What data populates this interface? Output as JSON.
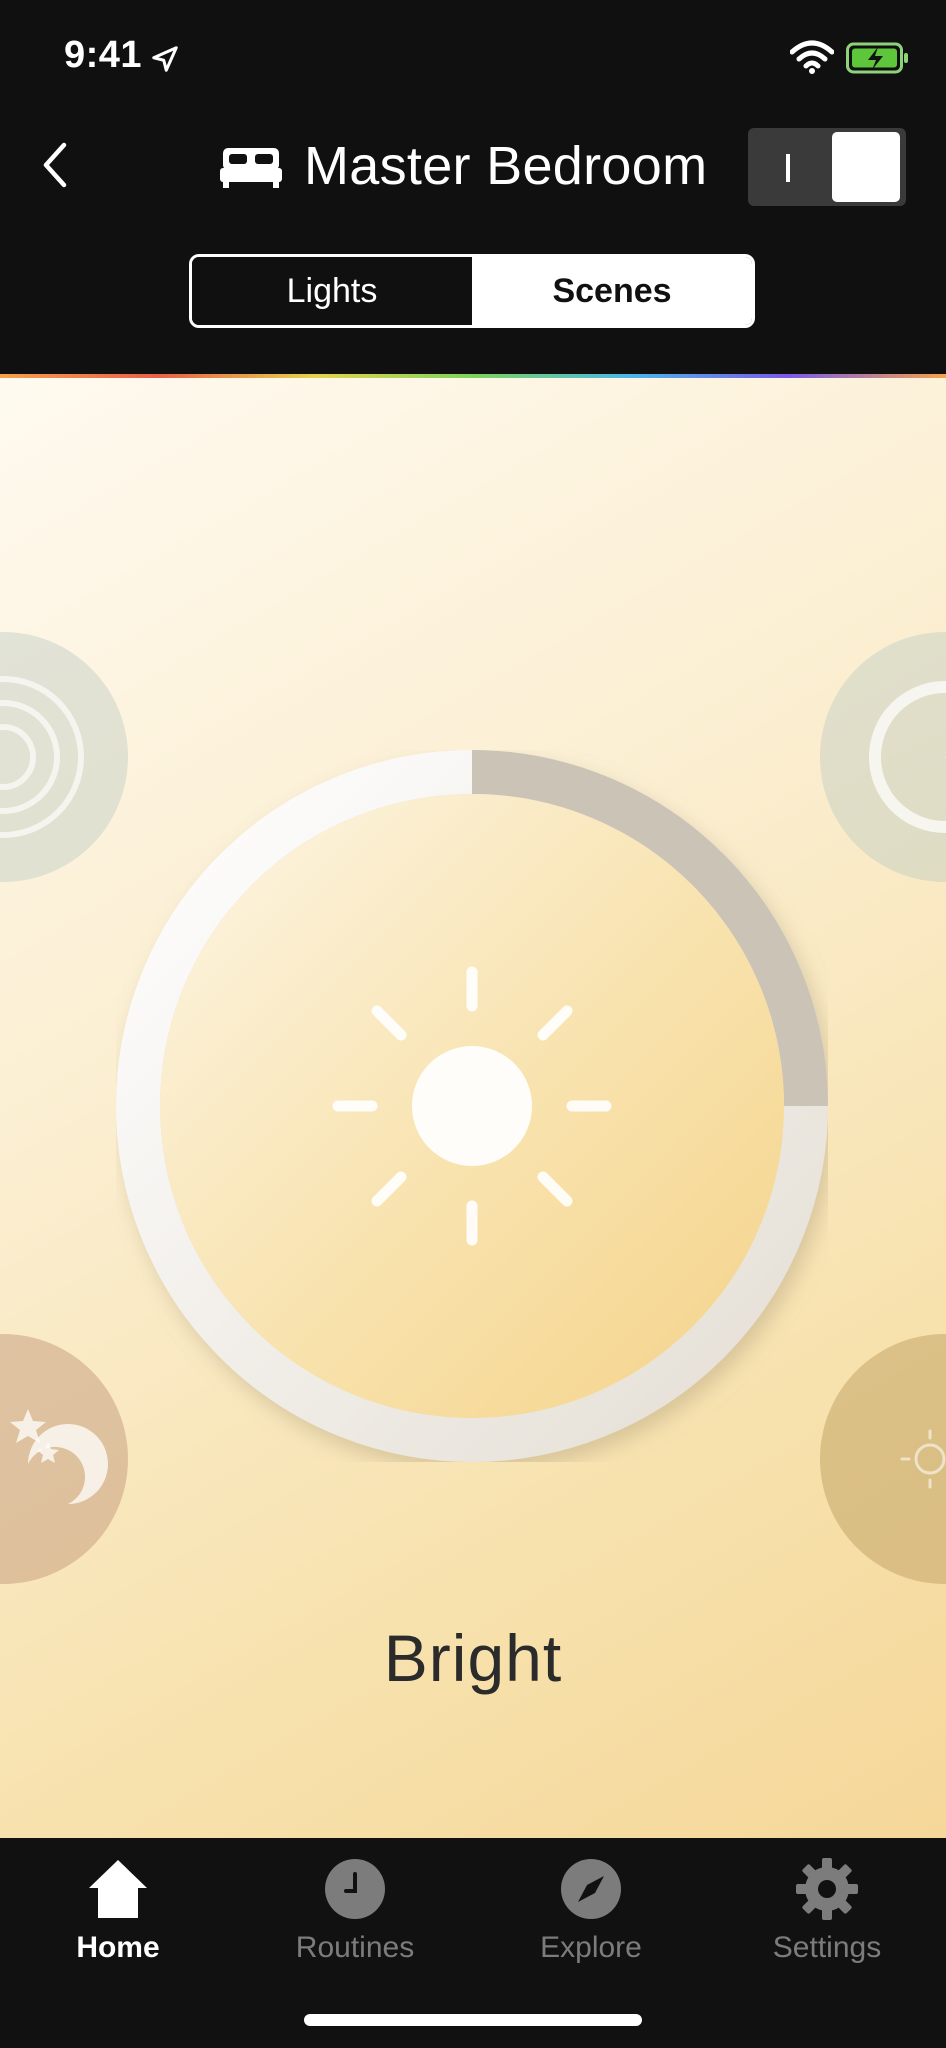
{
  "status_bar": {
    "time": "9:41"
  },
  "header": {
    "title": "Master Bedroom",
    "toggle_on": true
  },
  "segments": [
    {
      "label": "Lights",
      "active": false
    },
    {
      "label": "Scenes",
      "active": true
    }
  ],
  "scene": {
    "name": "Bright",
    "brightness_fraction": 0.25,
    "icon": "sun-icon"
  },
  "tabs": [
    {
      "label": "Home",
      "icon": "home-icon",
      "active": true
    },
    {
      "label": "Routines",
      "icon": "clock-icon",
      "active": false
    },
    {
      "label": "Explore",
      "icon": "compass-icon",
      "active": false
    },
    {
      "label": "Settings",
      "icon": "gear-icon",
      "active": false
    }
  ],
  "colors": {
    "background": "#101010",
    "accent": "#ffffff",
    "scene_warm": "#f7e1ac"
  }
}
